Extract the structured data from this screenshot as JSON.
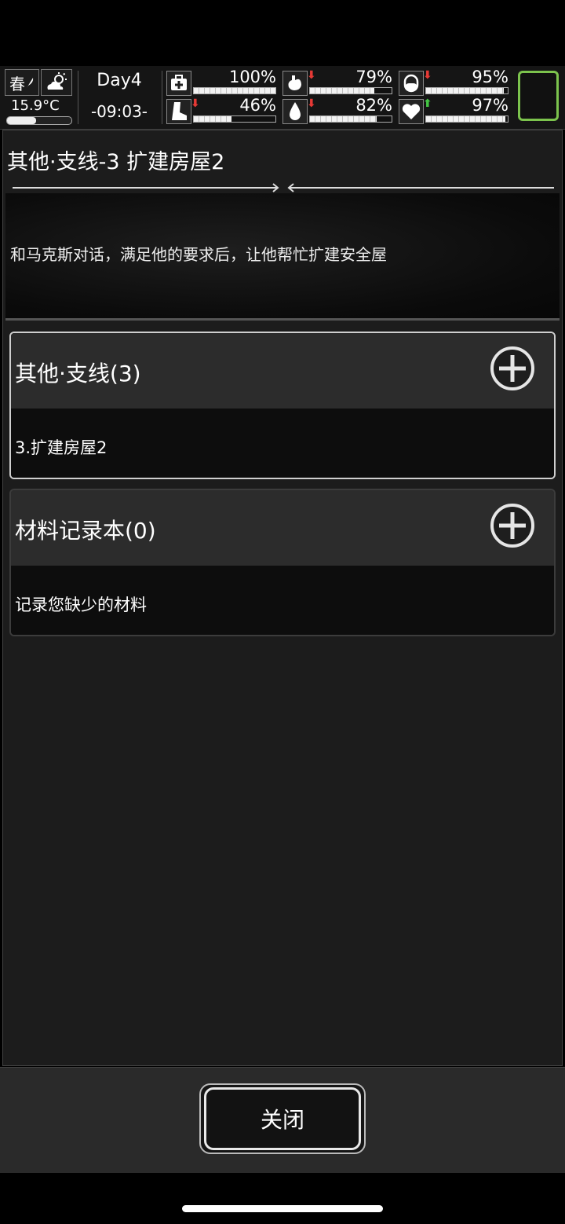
{
  "status": {
    "season": "春",
    "temperature": "15.9°C",
    "temperature_level": 0.45,
    "day": "Day4",
    "time": "-09:03-",
    "stats": [
      {
        "name": "health",
        "icon": "medkit-icon",
        "value": "100%",
        "level": 1.0,
        "trend": "none"
      },
      {
        "name": "hunger",
        "icon": "stomach-icon",
        "value": "79%",
        "level": 0.79,
        "trend": "down"
      },
      {
        "name": "medicine",
        "icon": "pill-icon",
        "value": "95%",
        "level": 0.95,
        "trend": "down"
      },
      {
        "name": "stamina",
        "icon": "boot-icon",
        "value": "46%",
        "level": 0.46,
        "trend": "down"
      },
      {
        "name": "thirst",
        "icon": "water-drop-icon",
        "value": "82%",
        "level": 0.82,
        "trend": "down"
      },
      {
        "name": "mood",
        "icon": "heart-icon",
        "value": "97%",
        "level": 0.97,
        "trend": "up"
      }
    ],
    "trend_colors": {
      "down": "#e53935",
      "up": "#43c443"
    }
  },
  "quest": {
    "title": "其他·支线-3 扩建房屋2",
    "description": "和马克斯对话，满足他的要求后，让他帮忙扩建安全屋"
  },
  "cards": [
    {
      "title": "其他·支线(3)",
      "subtitle": "3.扩建房屋2"
    },
    {
      "title": "材料记录本(0)",
      "subtitle": "记录您缺少的材料"
    }
  ],
  "footer": {
    "close_label": "关闭"
  }
}
